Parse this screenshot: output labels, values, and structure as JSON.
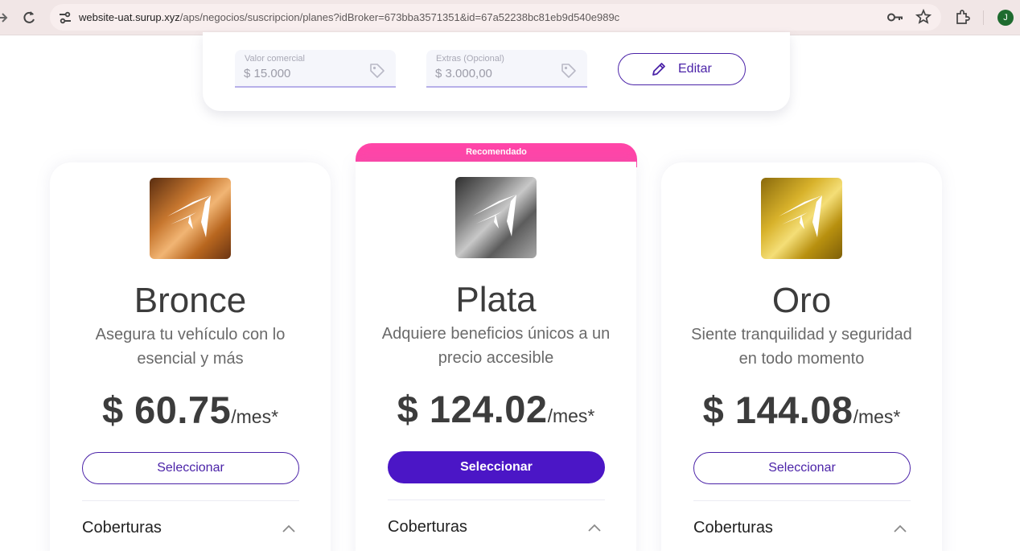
{
  "browser": {
    "url_host": "website-uat.surup.xyz",
    "url_path": "/aps/negocios/suscripcion/planes?idBroker=673bba3571351&id=67a52238bc81eb9d540e989c",
    "profile_initial": "J"
  },
  "search": {
    "commercial_value": {
      "label": "Valor comercial",
      "value": "$ 15.000"
    },
    "extras": {
      "label": "Extras (Opcional)",
      "value": "$ 3.000,00"
    },
    "edit_label": "Editar"
  },
  "badge": "Recomendado",
  "plans": [
    {
      "name": "Bronce",
      "description": "Asegura tu vehículo con lo esencial y más",
      "price": "$ 60.75",
      "per": "/mes*",
      "select_label": "Seleccionar",
      "coverage_label": "Coberturas"
    },
    {
      "name": "Plata",
      "description": "Adquiere beneficios únicos a un precio accesible",
      "price": "$ 124.02",
      "per": "/mes*",
      "select_label": "Seleccionar",
      "coverage_label": "Coberturas"
    },
    {
      "name": "Oro",
      "description": "Siente tranquilidad y seguridad en todo momento",
      "price": "$ 144.08",
      "per": "/mes*",
      "select_label": "Seleccionar",
      "coverage_label": "Coberturas"
    }
  ],
  "colors": {
    "accent": "#4b16c6",
    "badge": "#ff45a8",
    "bronze": "#b86a2a",
    "silver": "#6f6f6f",
    "gold": "#c9a21c"
  },
  "icons": [
    "forward-icon",
    "reload-icon",
    "site-settings-icon",
    "key-icon",
    "star-icon",
    "extensions-icon",
    "tag-icon",
    "pencil-icon",
    "chevron-up-icon"
  ]
}
